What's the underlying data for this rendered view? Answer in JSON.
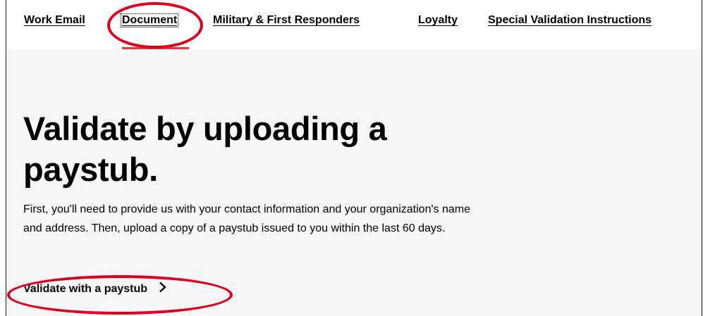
{
  "tabs": [
    {
      "label": "Work Email",
      "active": false
    },
    {
      "label": "Document",
      "active": true
    },
    {
      "label": "Military & First Responders",
      "active": false
    },
    {
      "label": "Loyalty",
      "active": false
    },
    {
      "label": "Special Validation Instructions",
      "active": false
    }
  ],
  "main": {
    "headline": "Validate by uploading a paystub.",
    "description": "First, you'll need to provide us with your contact information and your organization's name and address. Then, upload a copy of a paystub issued to you within the last 60 days.",
    "cta_label": "Validate with a paystub",
    "cta_icon": "chevron-right-icon"
  },
  "colors": {
    "active_tab_indicator": "#e53b3b",
    "annotation": "#e0001b",
    "content_background": "#f6f6f6"
  }
}
